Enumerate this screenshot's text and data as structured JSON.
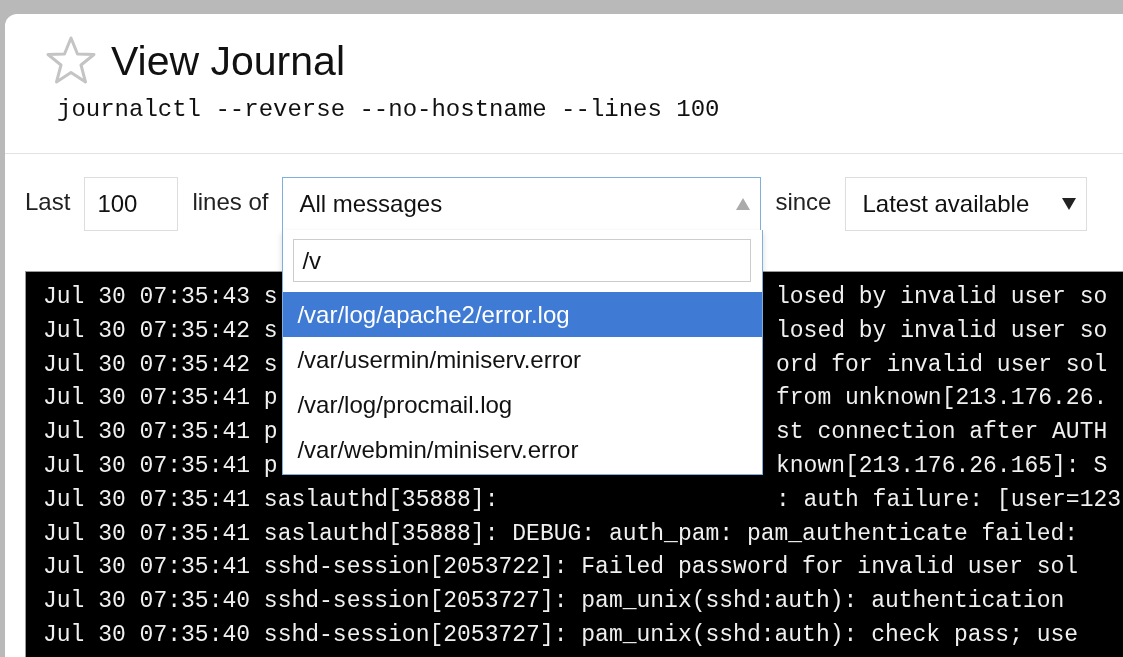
{
  "header": {
    "title": "View Journal",
    "command": "journalctl --reverse --no-hostname --lines 100",
    "favorite": false
  },
  "filters": {
    "last_label": "Last",
    "lines_value": "100",
    "lines_of_label": "lines of",
    "source": {
      "value": "All messages",
      "expanded": true,
      "search_value": "/v",
      "options": [
        {
          "label": "/var/log/apache2/error.log",
          "selected": true
        },
        {
          "label": "/var/usermin/miniserv.error",
          "selected": false
        },
        {
          "label": "/var/log/procmail.log",
          "selected": false
        },
        {
          "label": "/var/webmin/miniserv.error",
          "selected": false
        }
      ]
    },
    "since_label": "since",
    "since": {
      "value": "Latest available"
    }
  },
  "log_lines": [
    {
      "kind": "split",
      "left": "Jul 30 07:35:43 s",
      "right": "losed by invalid user so"
    },
    {
      "kind": "split",
      "left": "Jul 30 07:35:42 s",
      "right": "losed by invalid user so"
    },
    {
      "kind": "split",
      "left": "Jul 30 07:35:42 s",
      "right": "ord for invalid user sol"
    },
    {
      "kind": "split",
      "left": "Jul 30 07:35:41 p",
      "right": "from unknown[213.176.26."
    },
    {
      "kind": "split",
      "left": "Jul 30 07:35:41 p",
      "right": "st connection after AUTH"
    },
    {
      "kind": "split",
      "left": "Jul 30 07:35:41 p",
      "right": "known[213.176.26.165]: S"
    },
    {
      "kind": "split",
      "left": "Jul 30 07:35:41 saslauthd[35888]:",
      "right": ": auth failure: [user=123"
    },
    {
      "kind": "full",
      "text": "Jul 30 07:35:41 saslauthd[35888]: DEBUG: auth_pam: pam_authenticate failed:"
    },
    {
      "kind": "full",
      "text": "Jul 30 07:35:41 sshd-session[2053722]: Failed password for invalid user sol"
    },
    {
      "kind": "full",
      "text": "Jul 30 07:35:40 sshd-session[2053727]: pam_unix(sshd:auth): authentication"
    },
    {
      "kind": "full",
      "text": "Jul 30 07:35:40 sshd-session[2053727]: pam_unix(sshd:auth): check pass; use"
    }
  ]
}
